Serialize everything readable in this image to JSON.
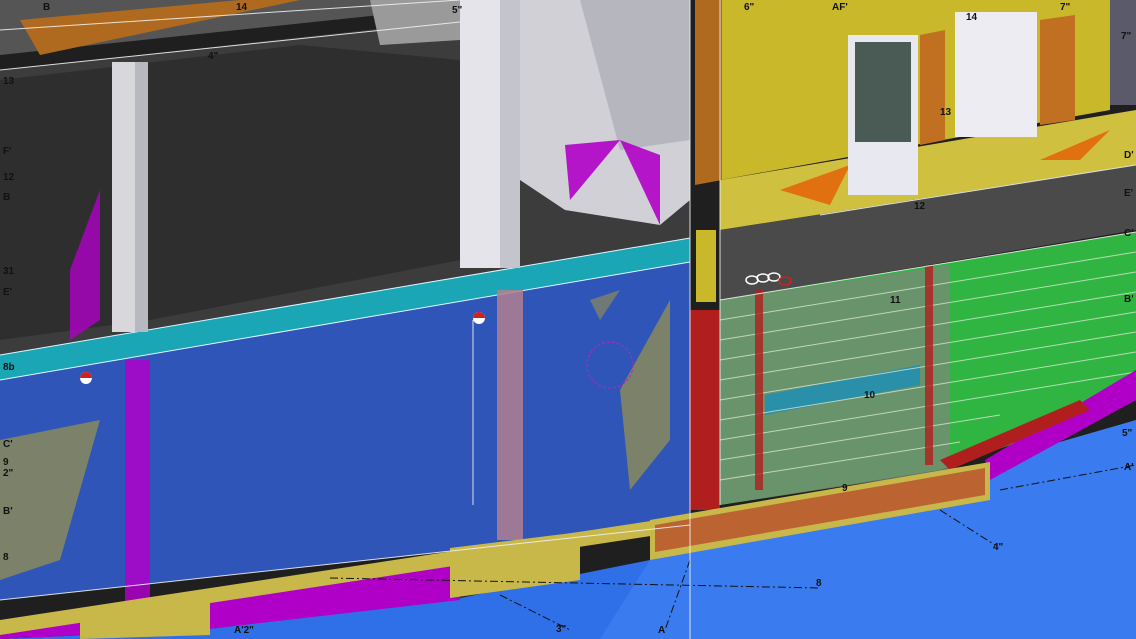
{
  "colors": {
    "wall_yellow": "#c8b82a",
    "wall_blue": "#2f55b8",
    "ground_blue": "#2f6fe8",
    "slab_dark": "#3c3c3c",
    "rebar_green": "#34d04a",
    "rebar_red": "#b01e1e",
    "magenta": "#b000c8",
    "column_grey": "#d8d8dc",
    "orange": "#c46a10",
    "cyan_beam": "#1aa6b5",
    "footing_yellow": "#c8b84a"
  },
  "icons": [
    "section-marker-icon",
    "section-marker-icon",
    "lift-point-icon",
    "insertion-circle-icon"
  ],
  "labels": {
    "top_b": "B",
    "top_14": "14",
    "top_5dd": "5\"",
    "top_4d": "4\"",
    "top_6dd": "6\"",
    "top_afp": "AF'",
    "top_14b": "14",
    "top_7dd": "7\"",
    "right_7dd": "7\"",
    "left_13": "13",
    "mid_13": "13",
    "left_fp": "F'",
    "left_12": "12",
    "left_b": "B",
    "mid_12": "12",
    "right_dp": "D'",
    "right_ep": "E'",
    "right_cp": "C'",
    "left_31": "31",
    "left_ep": "E'",
    "right_bp": "B'",
    "mid_11": "11",
    "left_8b": "8b",
    "mid_10": "10",
    "left_cp": "C'",
    "left_9": "9",
    "left_2dd": "2\"",
    "right_5dd": "5\"",
    "right_ap": "A'",
    "mid_9": "9",
    "left_bp": "B'",
    "bot_4dd": "4\"",
    "left_8": "8",
    "bot_8": "8",
    "bot_3dd": "3\"",
    "bot_a2": "A'2\"",
    "bot_a": "A"
  }
}
